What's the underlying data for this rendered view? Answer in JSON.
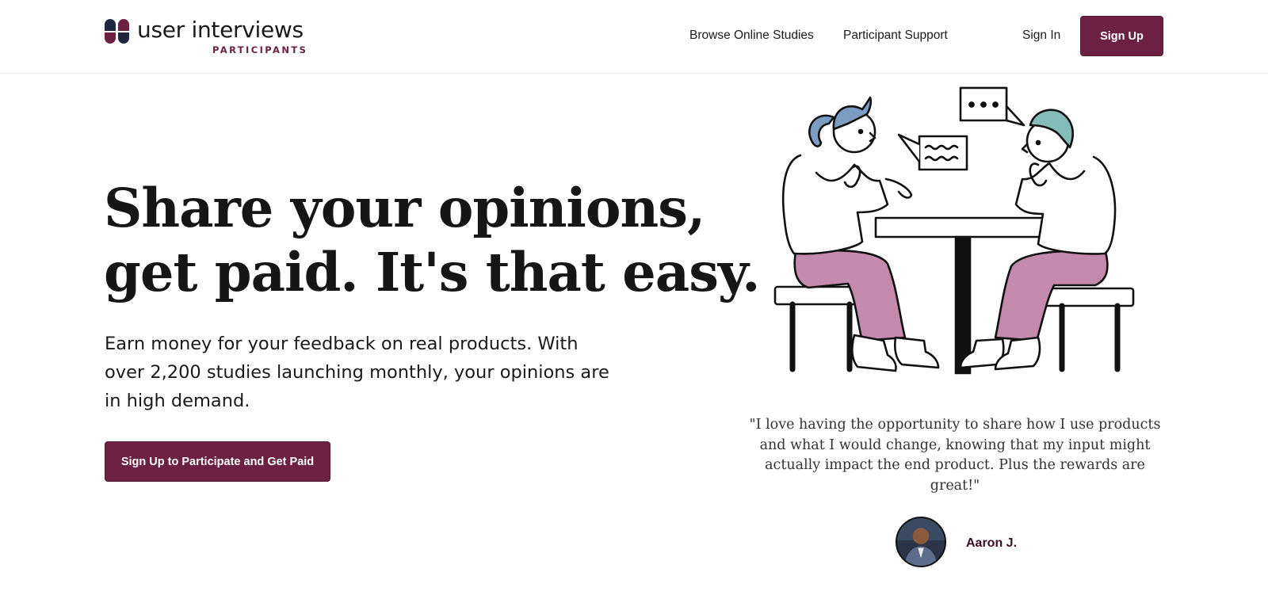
{
  "brand": {
    "name": "user interviews",
    "sub": "PARTICIPANTS",
    "accent_color": "#6c2143",
    "logo_icon": "user-interviews-logo-icon"
  },
  "nav": {
    "browse": "Browse Online Studies",
    "support": "Participant Support",
    "signin": "Sign In",
    "signup": "Sign Up"
  },
  "hero": {
    "title_line1": "Share your opinions,",
    "title_line2": "get paid. It's that easy.",
    "subtitle": "Earn money for your feedback on real products. With over 2,200 studies launching monthly, your opinions are in high demand.",
    "cta": "Sign Up to Participate and Get Paid",
    "illustration_icon": "two-people-interview-illustration"
  },
  "testimonial": {
    "quote": "\"I love having the opportunity to share how I use products and what I would change, knowing that my input might actually impact the end product. Plus the rewards are great!\"",
    "author": "Aaron J.",
    "avatar_icon": "avatar-photo"
  }
}
